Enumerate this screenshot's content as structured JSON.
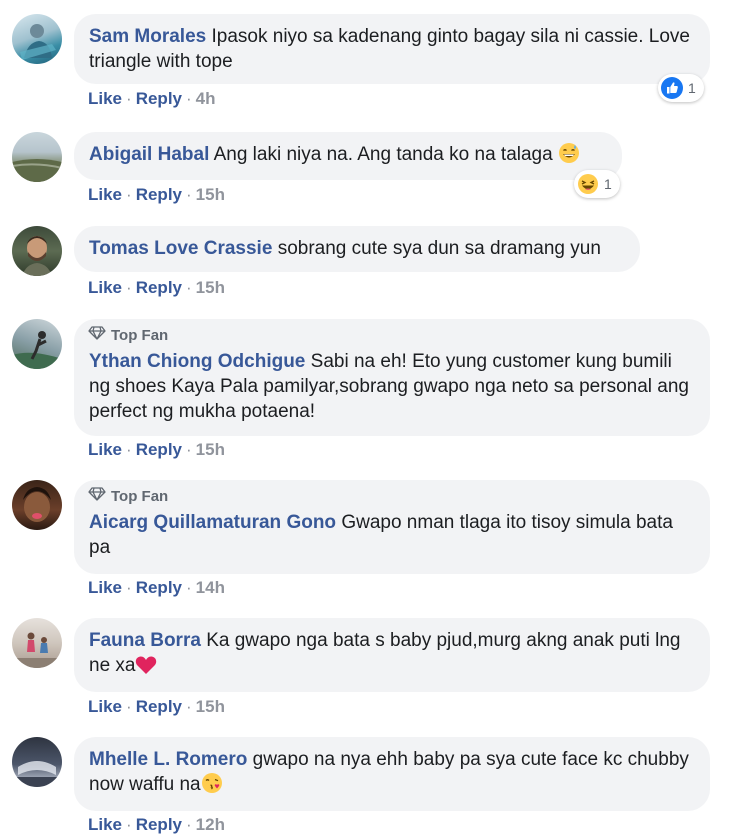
{
  "colors": {
    "author": "#385898",
    "bubble": "#f2f3f5",
    "meta": "#90949c",
    "like_blue": "#1877f2",
    "heart": "#e0245e"
  },
  "comments": [
    {
      "author": "Sam Morales",
      "text": "Ipasok niyo sa kadenang ginto bagay sila ni cassie. Love triangle with tope",
      "like": "Like",
      "reply": "Reply",
      "time": "4h",
      "reaction": {
        "icon": "like-icon",
        "count": "1"
      }
    },
    {
      "author": "Abigail Habal",
      "text": "Ang laki niya na. Ang tanda ko na talaga",
      "emoji": "grinning-sweat-emoji",
      "like": "Like",
      "reply": "Reply",
      "time": "15h",
      "reaction": {
        "icon": "haha-icon",
        "count": "1"
      }
    },
    {
      "author": "Tomas Love Crassie",
      "text": "sobrang cute sya dun sa dramang yun",
      "like": "Like",
      "reply": "Reply",
      "time": "15h"
    },
    {
      "badge": "Top Fan",
      "author": "Ythan Chiong Odchigue",
      "text": "Sabi na eh! Eto yung customer kung bumili ng shoes Kaya Pala pamilyar,sobrang gwapo nga neto sa personal ang perfect ng mukha potaena!",
      "like": "Like",
      "reply": "Reply",
      "time": "15h"
    },
    {
      "badge": "Top Fan",
      "author": "Aicarg Quillamaturan Gono",
      "text": "Gwapo nman tlaga ito tisoy simula bata pa",
      "like": "Like",
      "reply": "Reply",
      "time": "14h"
    },
    {
      "author": "Fauna Borra",
      "text": "Ka gwapo nga bata s baby pjud,murg akng anak puti lng ne xa",
      "emoji": "red-heart-emoji",
      "like": "Like",
      "reply": "Reply",
      "time": "15h"
    },
    {
      "author": "Mhelle L. Romero",
      "text": "gwapo na nya ehh baby pa sya cute face kc chubby now waffu na",
      "emoji": "face-blowing-kiss-emoji",
      "like": "Like",
      "reply": "Reply",
      "time": "12h"
    }
  ]
}
